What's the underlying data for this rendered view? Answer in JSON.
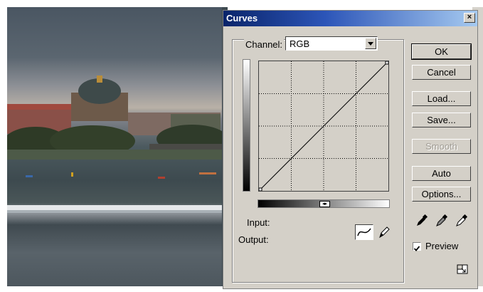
{
  "dialog": {
    "title": "Curves",
    "close_label": "×",
    "channel_label": "Channel:",
    "channel_value": "RGB",
    "input_label": "Input:",
    "output_label": "Output:",
    "buttons": {
      "ok": "OK",
      "cancel": "Cancel",
      "load": "Load...",
      "save": "Save...",
      "smooth": "Smooth",
      "auto": "Auto",
      "options": "Options..."
    },
    "preview_label": "Preview",
    "preview_checked": true,
    "icons": [
      "black-eyedropper-icon",
      "gray-eyedropper-icon",
      "white-eyedropper-icon",
      "curve-tool-icon",
      "pencil-tool-icon",
      "expand-icon",
      "gradient-toggle-icon"
    ]
  },
  "colors": {
    "title_start": "#0a246a",
    "dialog_bg": "#d4d0c8"
  }
}
